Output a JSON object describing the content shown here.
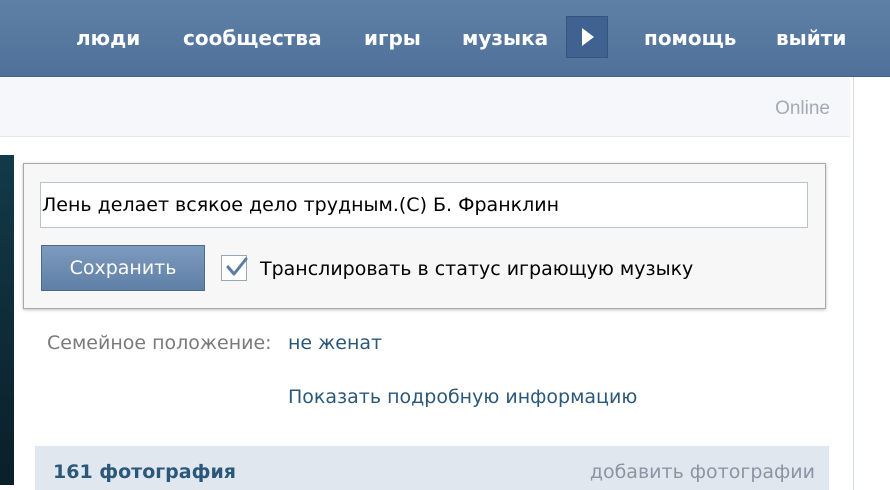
{
  "nav": {
    "people": "люди",
    "communities": "сообщества",
    "games": "игры",
    "music": "музыка",
    "help": "помощь",
    "logout": "выйти"
  },
  "profile": {
    "online_status": "Online",
    "family_label": "Семейное положение:",
    "family_value": "не женат",
    "show_more": "Показать подробную информацию"
  },
  "status_popup": {
    "status_text": "Лень делает всякое дело трудным.(С) Б. Франклин",
    "save_label": "Сохранить",
    "broadcast_label": "Транслировать в статус играющую музыку",
    "broadcast_checked": true
  },
  "photos": {
    "count_label": "161 фотография",
    "add_label": "добавить фотографии"
  },
  "colors": {
    "nav_bg": "#5677a0",
    "link": "#2b587a",
    "button": "#6d8db3"
  },
  "icons": {
    "play": "play-icon",
    "check": "checkmark-icon"
  }
}
